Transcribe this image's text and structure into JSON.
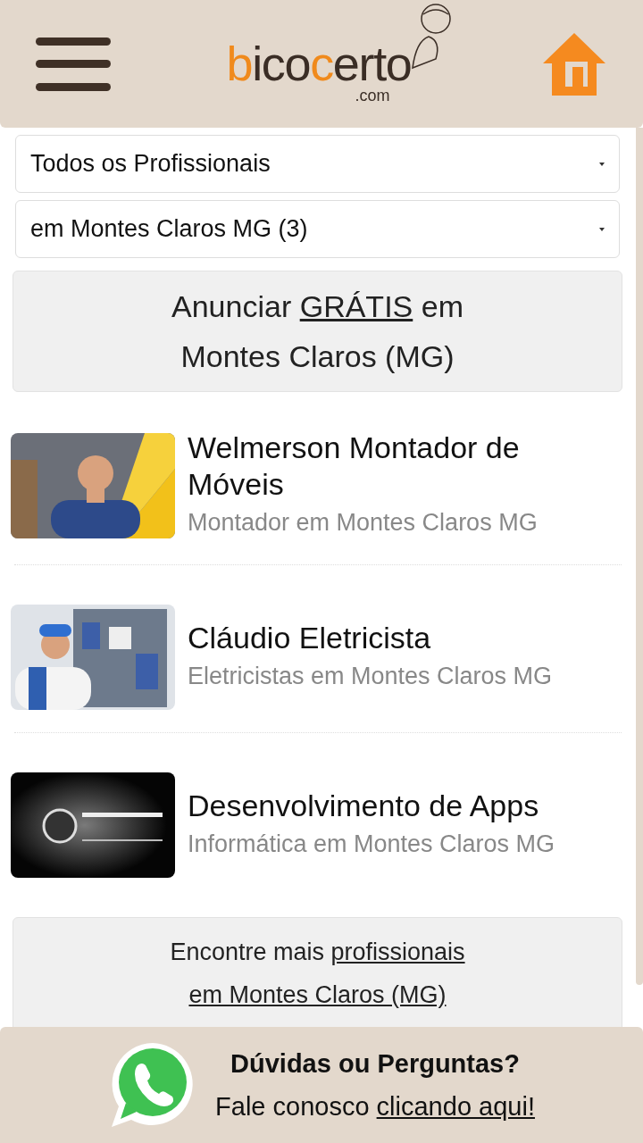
{
  "header": {
    "logo": {
      "parts": [
        {
          "text": "b",
          "accent": true
        },
        {
          "text": "ico",
          "accent": false
        },
        {
          "text": "c",
          "accent": true
        },
        {
          "text": "erto",
          "accent": false
        }
      ],
      "suffix": ".com"
    }
  },
  "filters": [
    {
      "value": "Todos os Profissionais"
    },
    {
      "value": "em Montes Claros MG (3)"
    }
  ],
  "announce": {
    "before": "Anunciar",
    "link": "GRÁTIS",
    "after": "em",
    "line2": "Montes Claros (MG)"
  },
  "listings": [
    {
      "title": "Welmerson Montador de Móveis",
      "subtitle": "Montador em Montes Claros MG"
    },
    {
      "title": "Cláudio Eletricista",
      "subtitle": "Eletricistas em Montes Claros MG"
    },
    {
      "title": "Desenvolvimento de Apps",
      "subtitle": "Informática em Montes Claros MG"
    }
  ],
  "more": {
    "before": "Encontre mais",
    "link1": "profissionais",
    "link2": "em Montes Claros (MG)"
  },
  "footer": {
    "title": "Dúvidas ou Perguntas?",
    "before": "Fale conosco",
    "link": "clicando aqui!"
  }
}
